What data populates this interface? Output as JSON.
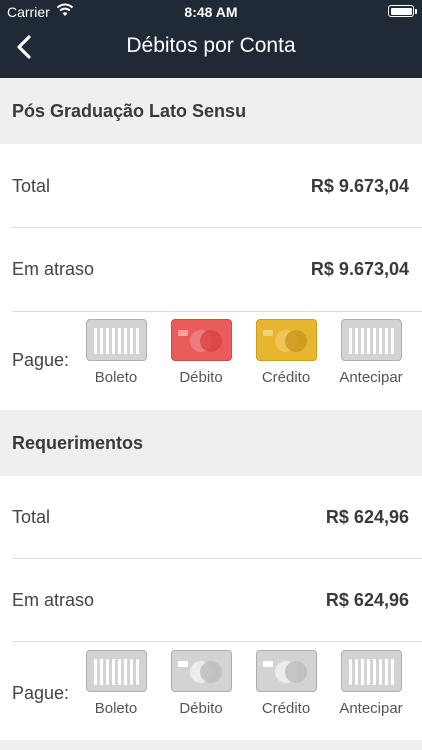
{
  "status_bar": {
    "carrier": "Carrier",
    "time": "8:48 AM"
  },
  "nav": {
    "title": "Débitos por Conta",
    "back_icon": "chevron-left-icon"
  },
  "accounts": [
    {
      "name": "Pós Graduação Lato Sensu",
      "total_label": "Total",
      "total_value": "R$ 9.673,04",
      "overdue_label": "Em atraso",
      "overdue_value": "R$ 9.673,04",
      "pay_label": "Pague:",
      "options": [
        {
          "label": "Boleto",
          "icon": "boleto-barcode-icon",
          "color": "#d3d3d3",
          "active": false
        },
        {
          "label": "Débito",
          "icon": "debit-card-icon",
          "color": "#ea5c5c",
          "active": true
        },
        {
          "label": "Crédito",
          "icon": "credit-card-icon",
          "color": "#e7b630",
          "active": true
        },
        {
          "label": "Antecipar",
          "icon": "anticipate-barcode-icon",
          "color": "#d3d3d3",
          "active": false
        }
      ]
    },
    {
      "name": "Requerimentos",
      "total_label": "Total",
      "total_value": "R$ 624,96",
      "overdue_label": "Em atraso",
      "overdue_value": "R$ 624,96",
      "pay_label": "Pague:",
      "options": [
        {
          "label": "Boleto",
          "icon": "boleto-barcode-icon",
          "color": "#d3d3d3",
          "active": false
        },
        {
          "label": "Débito",
          "icon": "debit-card-icon",
          "color": "#d3d3d3",
          "active": false
        },
        {
          "label": "Crédito",
          "icon": "credit-card-icon",
          "color": "#d3d3d3",
          "active": false
        },
        {
          "label": "Antecipar",
          "icon": "anticipate-barcode-icon",
          "color": "#d3d3d3",
          "active": false
        }
      ]
    }
  ]
}
